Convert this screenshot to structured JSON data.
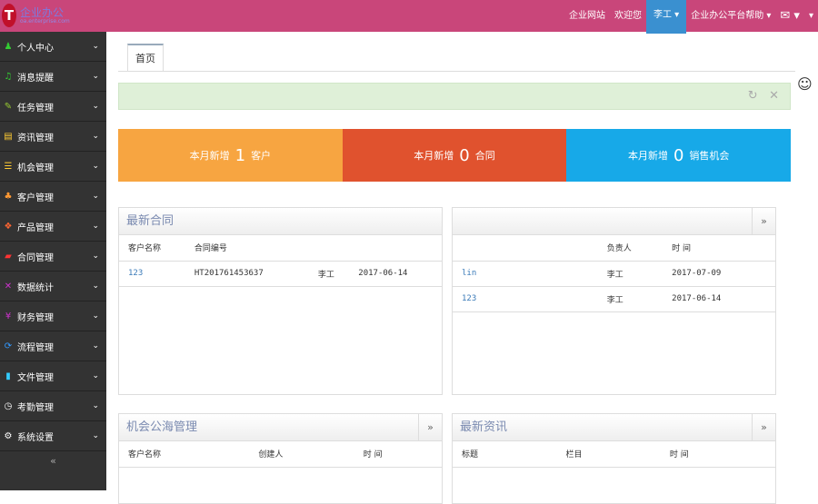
{
  "header": {
    "logo_letter": "T",
    "logo_title": "企业办公",
    "logo_sub": "oa.enterprise.com",
    "nav": [
      "企业网站",
      "欢迎您"
    ],
    "user": "李工",
    "help": "企业办公平台帮助",
    "mail_icon": "mail-icon"
  },
  "sidebar": {
    "items": [
      {
        "label": "个人中心",
        "icon": "user-icon",
        "glyph": "♟",
        "color": "#3c3"
      },
      {
        "label": "消息提醒",
        "icon": "bell-icon",
        "glyph": "♫",
        "color": "#3c3"
      },
      {
        "label": "任务管理",
        "icon": "edit-icon",
        "glyph": "✎",
        "color": "#9c3"
      },
      {
        "label": "资讯管理",
        "icon": "document-icon",
        "glyph": "▤",
        "color": "#fc3"
      },
      {
        "label": "机会管理",
        "icon": "list-icon",
        "glyph": "☰",
        "color": "#fc3"
      },
      {
        "label": "客户管理",
        "icon": "users-icon",
        "glyph": "♣",
        "color": "#f93"
      },
      {
        "label": "产品管理",
        "icon": "product-icon",
        "glyph": "❖",
        "color": "#f63"
      },
      {
        "label": "合同管理",
        "icon": "folder-icon",
        "glyph": "▰",
        "color": "#f33"
      },
      {
        "label": "数据统计",
        "icon": "random-icon",
        "glyph": "✕",
        "color": "#c3c"
      },
      {
        "label": "财务管理",
        "icon": "yen-icon",
        "glyph": "¥",
        "color": "#c3c"
      },
      {
        "label": "流程管理",
        "icon": "flow-icon",
        "glyph": "⟳",
        "color": "#39f"
      },
      {
        "label": "文件管理",
        "icon": "file-icon",
        "glyph": "▮",
        "color": "#3cf"
      },
      {
        "label": "考勤管理",
        "icon": "clock-icon",
        "glyph": "◷",
        "color": "#fff"
      },
      {
        "label": "系统设置",
        "icon": "gear-icon",
        "glyph": "⚙",
        "color": "#fff"
      }
    ],
    "collapse": "«"
  },
  "tabs": [
    "首页"
  ],
  "alert": {
    "refresh": "↻",
    "close": "✕"
  },
  "stats": [
    {
      "pre": "本月新增",
      "num": "1",
      "post": "客户",
      "color": "#f7a541"
    },
    {
      "pre": "本月新增",
      "num": "0",
      "post": "合同",
      "color": "#e0522e"
    },
    {
      "pre": "本月新增",
      "num": "0",
      "post": "销售机会",
      "color": "#17a9e8"
    }
  ],
  "contracts": {
    "title": "最新合同",
    "headers": [
      "客户名称",
      "合同编号",
      "",
      ""
    ],
    "rows": [
      [
        "123",
        "HT201761453637",
        "李工",
        "2017-06-14"
      ]
    ]
  },
  "customers": {
    "title": "",
    "more": "»",
    "headers": [
      "",
      "负责人",
      "时 间"
    ],
    "rows": [
      [
        "lin",
        "李工",
        "2017-07-09"
      ],
      [
        "123",
        "李工",
        "2017-06-14"
      ]
    ]
  },
  "opportunities": {
    "title": "机会公海管理",
    "more": "»",
    "headers": [
      "客户名称",
      "创建人",
      "时 间"
    ]
  },
  "news": {
    "title": "最新资讯",
    "more": "»",
    "headers": [
      "标题",
      "栏目",
      "时 间"
    ]
  }
}
